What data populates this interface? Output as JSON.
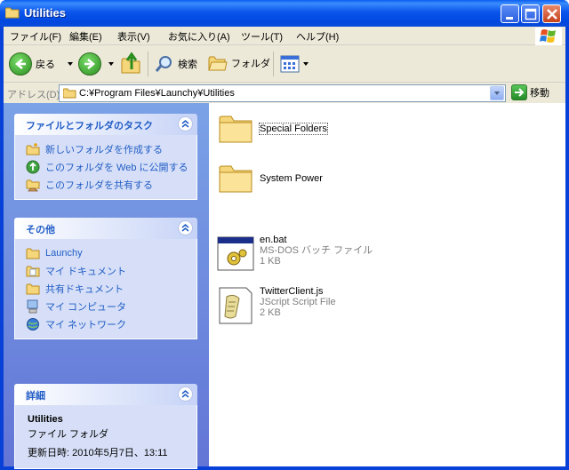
{
  "window": {
    "title": "Utilities"
  },
  "menu": {
    "items": [
      "ファイル(F)",
      "編集(E)",
      "表示(V)",
      "お気に入り(A)",
      "ツール(T)",
      "ヘルプ(H)"
    ]
  },
  "toolbar": {
    "back_label": "戻る",
    "search_label": "検索",
    "folders_label": "フォルダ"
  },
  "address": {
    "label": "アドレス(D)",
    "value": "C:¥Program Files¥Launchy¥Utilities",
    "go_label": "移動"
  },
  "tasks_panel": {
    "title": "ファイルとフォルダのタスク",
    "items": [
      {
        "label": "新しいフォルダを作成する",
        "icon": "new-folder-icon"
      },
      {
        "label": "このフォルダを Web に公開する",
        "icon": "web-publish-icon"
      },
      {
        "label": "このフォルダを共有する",
        "icon": "share-folder-icon"
      }
    ]
  },
  "other_panel": {
    "title": "その他",
    "items": [
      {
        "label": "Launchy",
        "icon": "folder-icon"
      },
      {
        "label": "マイ ドキュメント",
        "icon": "my-documents-icon"
      },
      {
        "label": "共有ドキュメント",
        "icon": "shared-documents-icon"
      },
      {
        "label": "マイ コンピュータ",
        "icon": "my-computer-icon"
      },
      {
        "label": "マイ ネットワーク",
        "icon": "my-network-icon"
      }
    ]
  },
  "details_panel": {
    "title": "詳細",
    "name": "Utilities",
    "type": "ファイル フォルダ",
    "modified": "更新日時: 2010年5月7日、13:11"
  },
  "files": [
    {
      "name": "Special Folders",
      "type": "",
      "size": "",
      "icon": "folder-icon"
    },
    {
      "name": "System Power",
      "type": "",
      "size": "",
      "icon": "folder-icon"
    },
    {
      "name": "en.bat",
      "type": "MS-DOS バッチ ファイル",
      "size": "1 KB",
      "icon": "batch-file-icon"
    },
    {
      "name": "TwitterClient.js",
      "type": "JScript Script File",
      "size": "2 KB",
      "icon": "script-file-icon"
    }
  ],
  "colors": {
    "title_blue": "#0b55ec",
    "task_link": "#215dc6",
    "pane_blue": "#7ba2e7",
    "chrome": "#ece9d8"
  }
}
